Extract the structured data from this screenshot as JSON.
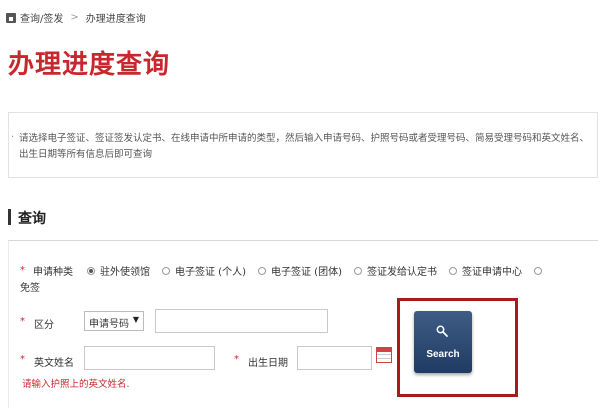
{
  "breadcrumb": {
    "items": [
      "查询/签发",
      "办理进度查询"
    ],
    "separator": ">"
  },
  "page_title": "办理进度查询",
  "notice": "请选择电子签证、签证签发认定书、在线申请中所申请的类型，然后输入申请号码、护照号码或者受理号码、简易受理号码和英文姓名、出生日期等所有信息后即可查询",
  "section_title": "查询",
  "form": {
    "application_type": {
      "required_mark": "*",
      "label": "申请种类",
      "options": [
        {
          "label": "驻外使领馆",
          "checked": true
        },
        {
          "label": "电子签证 (个人)",
          "checked": false
        },
        {
          "label": "电子签证 (团体)",
          "checked": false
        },
        {
          "label": "签证发给认定书",
          "checked": false
        },
        {
          "label": "签证申请中心",
          "checked": false
        },
        {
          "label": "",
          "checked": false
        }
      ],
      "wrap_option_label": "免签"
    },
    "category": {
      "required_mark": "*",
      "label": "区分",
      "select_value": "申请号码",
      "input_value": ""
    },
    "english_name": {
      "required_mark": "*",
      "label": "英文姓名",
      "value": ""
    },
    "birth_date": {
      "required_mark": "*",
      "label": "出生日期",
      "value": ""
    },
    "error": "请输入护照上的英文姓名.",
    "search_label": "Search"
  },
  "colors": {
    "title_red": "#c8282d",
    "button_blue": "#2b4a75",
    "highlight": "#a61b1b"
  }
}
